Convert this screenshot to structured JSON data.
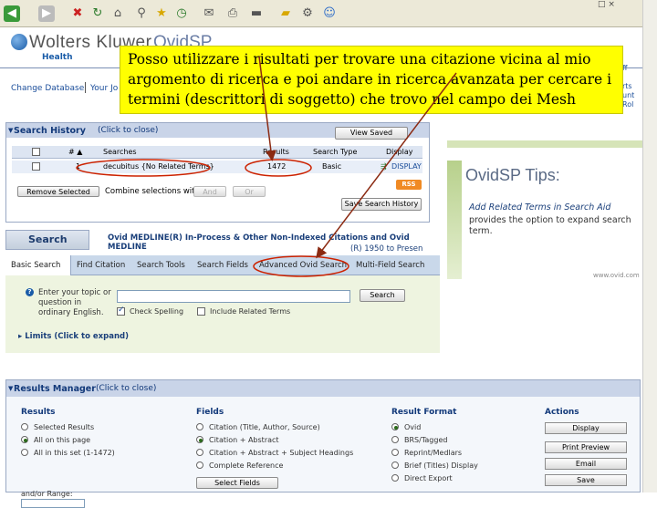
{
  "colors": {
    "callout": "#ffff00",
    "arrow": "#8b2a12",
    "highlight_oval": "#cc2200",
    "panel_header": "#c9d4e8",
    "link": "#1a4d9a"
  },
  "browser": {
    "window_label": "□ ×",
    "icons": [
      "back-icon",
      "forward-icon",
      "stop-icon",
      "refresh-icon",
      "home-icon",
      "search-icon",
      "favorites-icon",
      "history-icon",
      "mail-icon",
      "print-icon",
      "edit-icon",
      "folder-icon",
      "tools-icon",
      "messenger-icon"
    ]
  },
  "header": {
    "brand": "Wolters Kluwer",
    "brand_sub": "Health",
    "product": "OvidSP",
    "nav_change_db": "Change Database",
    "nav_your": "Your Jo",
    "right_links": [
      "ff",
      "rts",
      "unt",
      "Rol"
    ]
  },
  "callout": {
    "text": "Posso utilizzare i risultati per trovare una citazione vicina al mio argomento di ricerca e poi andare in ricerca avanzata per cercare i termini (descrittori di soggetto) che trovo nel campo dei Mesh"
  },
  "history": {
    "title": "Search History",
    "close_hint": "(Click to close)",
    "view_saved": "View Saved",
    "columns": {
      "num": "# ▲",
      "searches": "Searches",
      "results": "Results",
      "type": "Search Type",
      "display": "Display"
    },
    "rows": [
      {
        "num": "1",
        "search": "decubitus {No Related Terms}",
        "results": "1472",
        "type": "Basic",
        "display": "DISPLAY"
      }
    ],
    "remove_selected": "Remove Selected",
    "combine_label": "Combine selections with:",
    "and_label": "And",
    "or_label": "Or",
    "rss": "RSS",
    "save_search": "Save Search History"
  },
  "tips": {
    "title": "OvidSP Tips:",
    "line1": "Add Related Terms in Search Aid",
    "line2": "provides the option to expand search term.",
    "url": "www.ovid.com"
  },
  "search": {
    "tab_title": "Search",
    "db_line1": "Ovid MEDLINE(R) In-Process & Other Non-Indexed Citations and Ovid MEDLINE",
    "db_line2": "(R) 1950 to Presen",
    "tabs": [
      "Basic Search",
      "Find Citation",
      "Search Tools",
      "Search Fields",
      "Advanced Ovid Search",
      "Multi-Field Search"
    ],
    "prompt": "Enter your topic or question in ordinary English.",
    "input_value": "",
    "search_button": "Search",
    "spell_label": "Check Spelling",
    "related_label": "Include Related Terms",
    "limits": "Limits (Click to expand)"
  },
  "results_manager": {
    "title": "Results Manager",
    "close_hint": "(Click to close)",
    "results": {
      "heading": "Results",
      "options": [
        "Selected Results",
        "All on this page",
        "All in this set (1-1472)"
      ],
      "selected_index": 1,
      "range_label": "and/or Range:"
    },
    "fields": {
      "heading": "Fields",
      "options": [
        "Citation (Title, Author, Source)",
        "Citation + Abstract",
        "Citation + Abstract + Subject Headings",
        "Complete Reference"
      ],
      "selected_index": 1,
      "select_button": "Select Fields"
    },
    "format": {
      "heading": "Result Format",
      "options": [
        "Ovid",
        "BRS/Tagged",
        "Reprint/Medlars",
        "Brief (Titles) Display",
        "Direct Export"
      ],
      "selected_index": 0
    },
    "actions": {
      "heading": "Actions",
      "buttons": [
        "Display",
        "Print Preview",
        "Email",
        "Save"
      ]
    }
  }
}
